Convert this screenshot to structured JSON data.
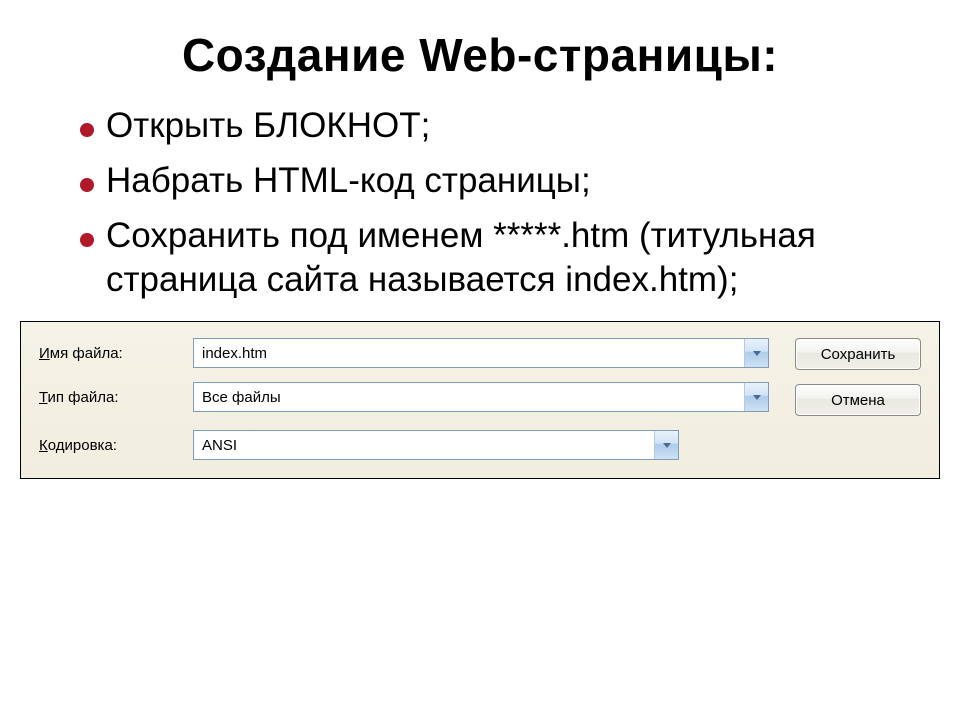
{
  "title": "Создание Web-страницы:",
  "bullets": [
    "Открыть  БЛОКНОТ;",
    "Набрать HTML-код страницы;",
    "Сохранить под именем *****.htm (титульная страница сайта называется index.htm);"
  ],
  "dialog": {
    "labels": {
      "filename_prefix": "И",
      "filename_rest": "мя файла:",
      "filetype_prefix": "Т",
      "filetype_rest": "ип файла:",
      "encoding_prefix": "К",
      "encoding_rest": "одировка:"
    },
    "values": {
      "filename": "index.htm",
      "filetype": "Все файлы",
      "encoding": "ANSI"
    },
    "buttons": {
      "save": "Сохранить",
      "cancel": "Отмена"
    }
  }
}
